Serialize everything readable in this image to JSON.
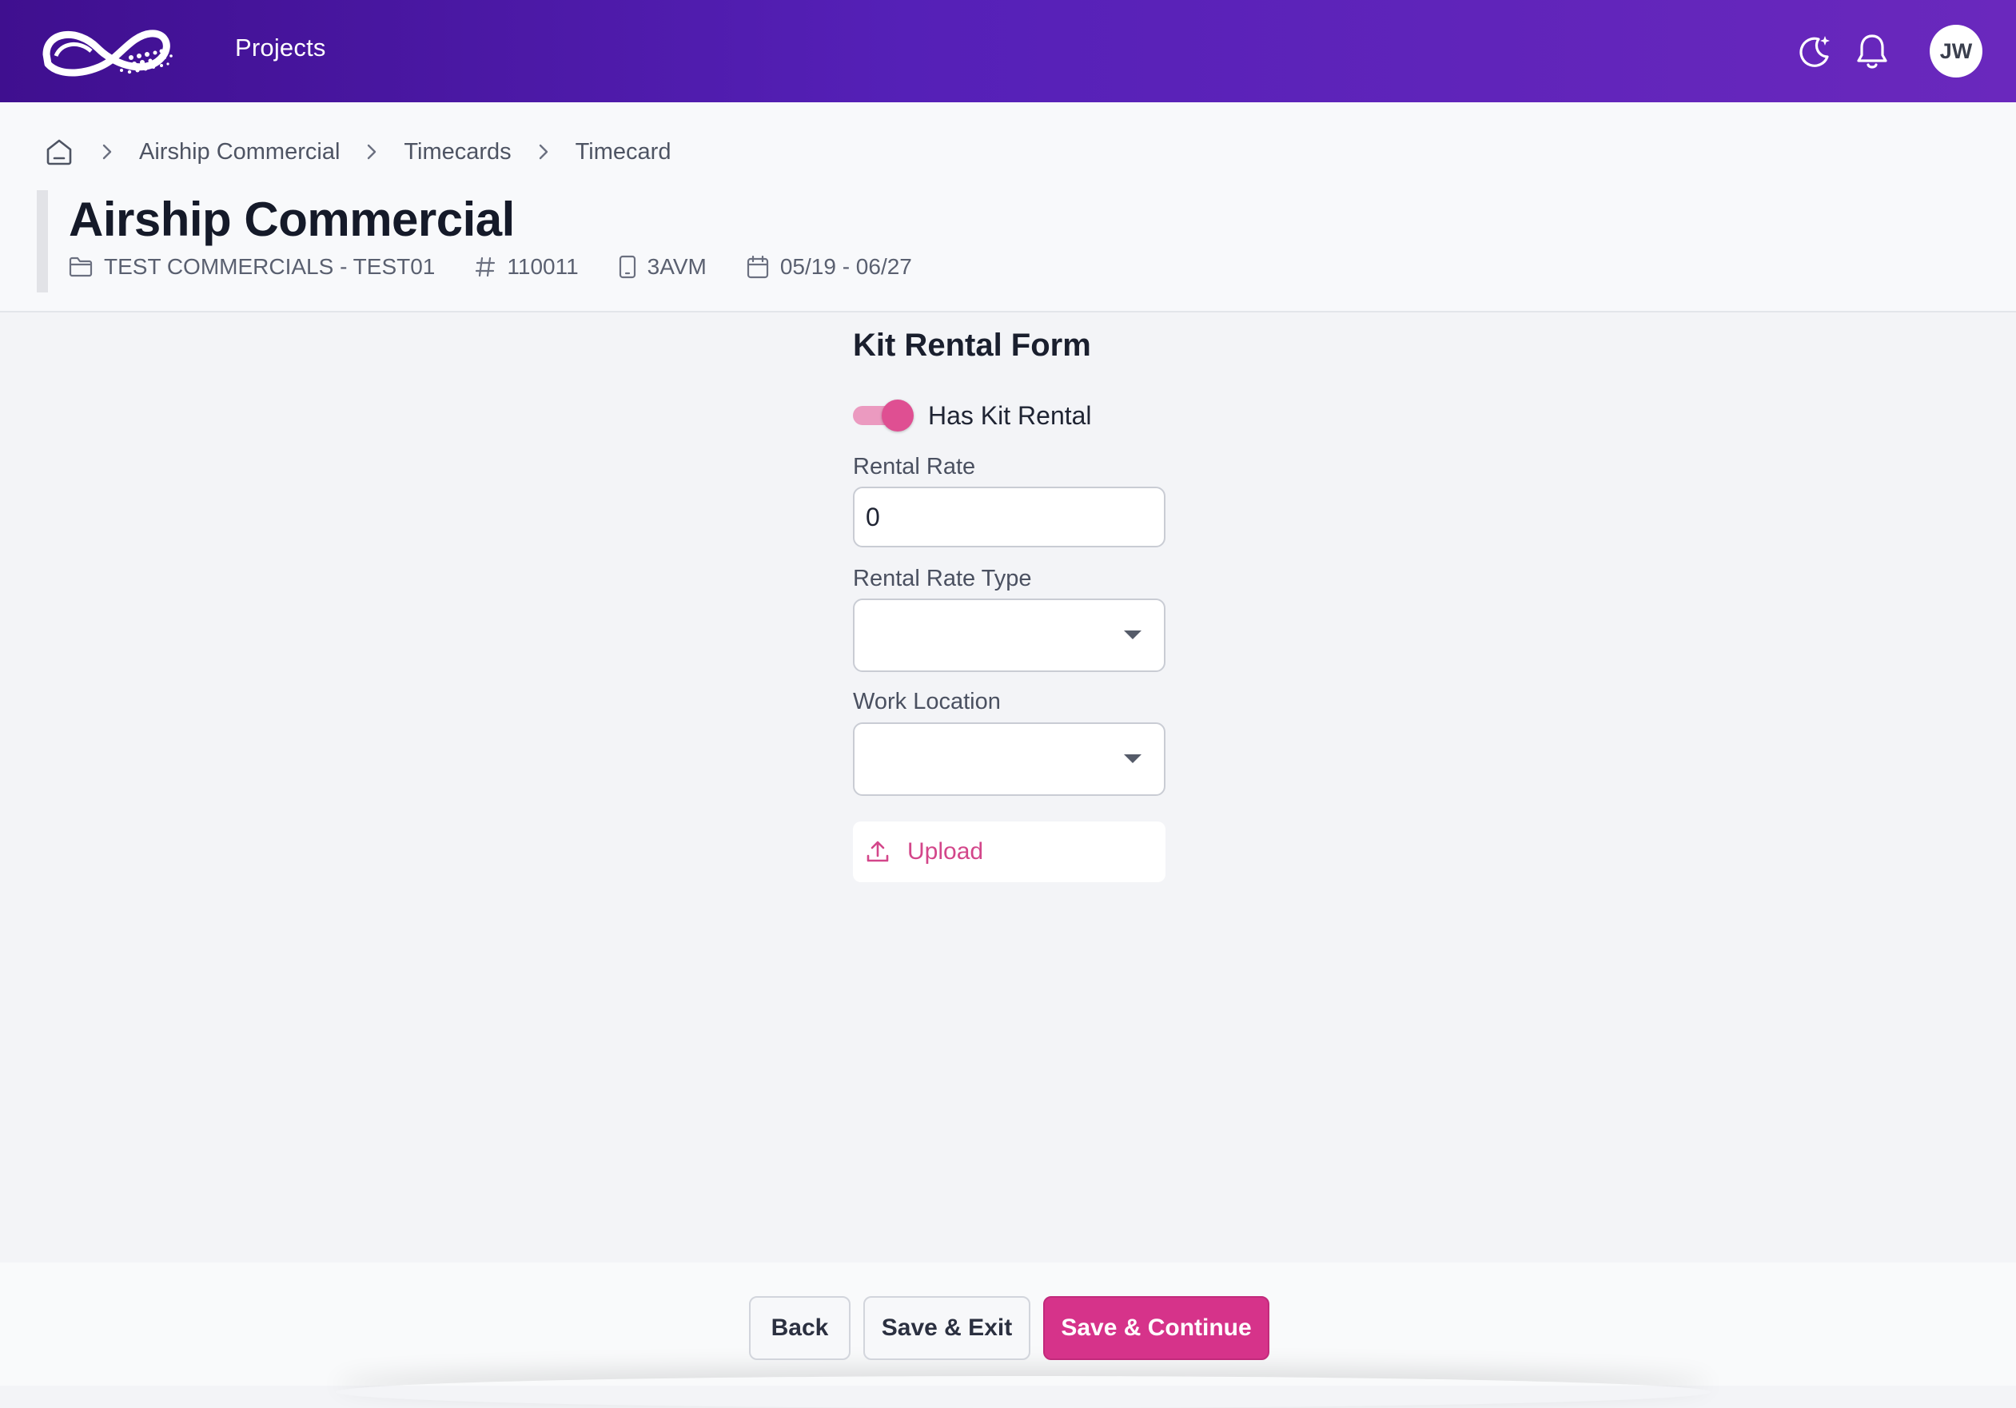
{
  "topbar": {
    "nav_label": "Projects",
    "avatar_initials": "JW",
    "icons": [
      "logo-icon",
      "theme-toggle-icon",
      "bell-icon"
    ]
  },
  "breadcrumb": {
    "items": [
      "Airship Commercial",
      "Timecards",
      "Timecard"
    ]
  },
  "project": {
    "title": "Airship Commercial",
    "folder": "TEST COMMERCIALS - TEST01",
    "number": "110011",
    "device": "3AVM",
    "dates": "05/19 - 06/27"
  },
  "form": {
    "title": "Kit Rental Form",
    "has_kit_rental_label": "Has Kit Rental",
    "has_kit_rental": true,
    "rental_rate_label": "Rental Rate",
    "rental_rate_value": "0",
    "rental_rate_type_label": "Rental Rate Type",
    "rental_rate_type_value": "",
    "work_location_label": "Work Location",
    "work_location_value": "",
    "upload_label": "Upload"
  },
  "footer": {
    "back_label": "Back",
    "save_exit_label": "Save & Exit",
    "save_continue_label": "Save & Continue"
  },
  "colors": {
    "accent": "#d6338a",
    "topbar_start": "#3f0f8f",
    "topbar_end": "#6a28bd",
    "toggle_track": "#eb9ac0"
  }
}
